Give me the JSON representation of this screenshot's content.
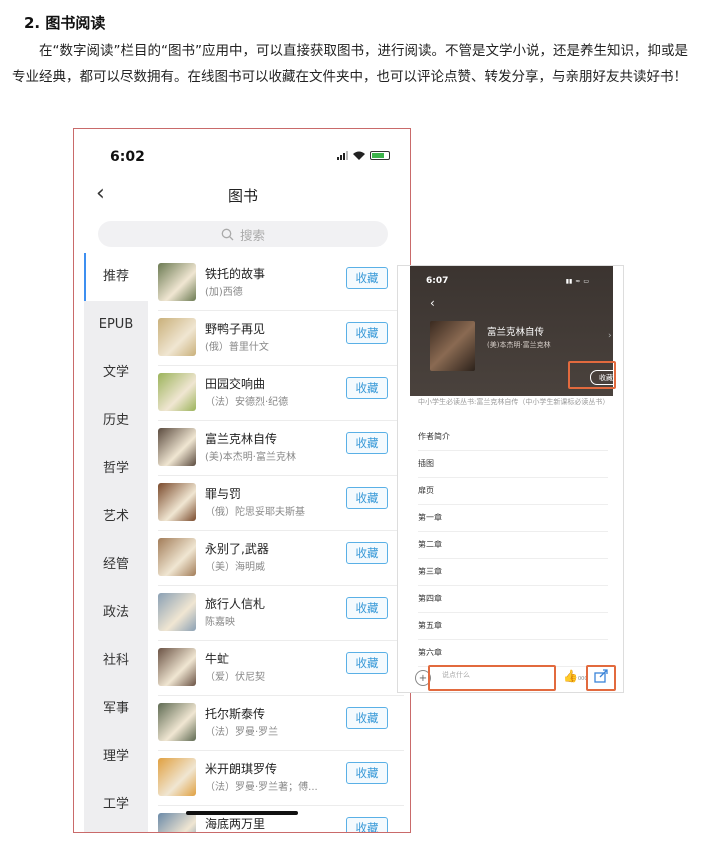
{
  "doc": {
    "heading": "2. 图书阅读",
    "paragraph": "在“数字阅读”栏目的“图书”应用中，可以直接获取图书，进行阅读。不管是文学小说，还是养生知识，抑或是专业经典，都可以尽数拥有。在线图书可以收藏在文件夹中，也可以评论点赞、转发分享，与亲朋好友共读好书！"
  },
  "phone1": {
    "time": "6:02",
    "back_icon": "chevron-left-icon",
    "title": "图书",
    "search_placeholder": "搜索",
    "categories": [
      "推荐",
      "EPUB",
      "文学",
      "历史",
      "哲学",
      "艺术",
      "经管",
      "政法",
      "社科",
      "军事",
      "理学",
      "工学"
    ],
    "books": [
      {
        "title": "铁托的故事",
        "author": "(加)西德",
        "action": "收藏",
        "cover_color": "#6b7a52"
      },
      {
        "title": "野鸭子再见",
        "author": "(俄）普里什文",
        "action": "收藏",
        "cover_color": "#c9b07a"
      },
      {
        "title": "田园交响曲",
        "author": "（法）安德烈·纪德",
        "action": "收藏",
        "cover_color": "#9bb35a"
      },
      {
        "title": "富兰克林自传",
        "author": "(美)本杰明·富兰克林",
        "action": "收藏",
        "cover_color": "#5a4a3e"
      },
      {
        "title": "罪与罚",
        "author": "（俄）陀思妥耶夫斯基",
        "action": "收藏",
        "cover_color": "#7a4a2c"
      },
      {
        "title": "永别了,武器",
        "author": "（美）海明威",
        "action": "收藏",
        "cover_color": "#a27c58"
      },
      {
        "title": "旅行人信札",
        "author": "陈嘉映",
        "action": "收藏",
        "cover_color": "#8aa0b4"
      },
      {
        "title": "牛虻",
        "author": "（爱）伏尼契",
        "action": "收藏",
        "cover_color": "#6a5244"
      },
      {
        "title": "托尔斯泰传",
        "author": "（法）罗曼·罗兰",
        "action": "收藏",
        "cover_color": "#5e6a52"
      },
      {
        "title": "米开朗琪罗传",
        "author": "（法）罗曼·罗兰著；傅...",
        "action": "收藏",
        "cover_color": "#e0a040"
      },
      {
        "title": "海底两万里",
        "author": "",
        "action": "收藏",
        "cover_color": "#6a8aa8"
      }
    ]
  },
  "phone2": {
    "time": "6:07",
    "book_title": "富兰克林自传",
    "book_author": "(美)本杰明·富兰克林",
    "fav_label": "收藏",
    "description": "中小学生必读丛书:富兰克林自传（中小学生新课标必读丛书）",
    "toc": [
      "作者简介",
      "插图",
      "扉页",
      "第一章",
      "第二章",
      "第三章",
      "第四章",
      "第五章",
      "第六章"
    ],
    "comment_placeholder": "说点什么",
    "like_count": "000"
  }
}
